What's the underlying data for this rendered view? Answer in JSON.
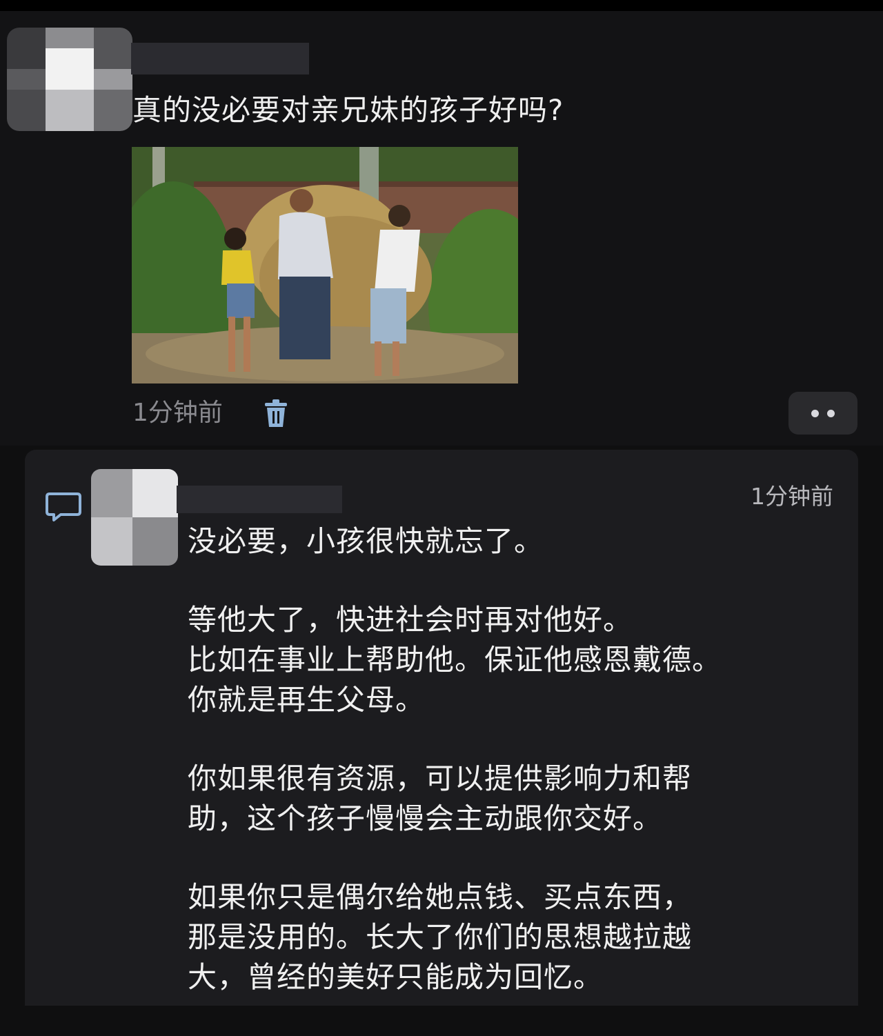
{
  "post": {
    "title": "真的没必要对亲兄妹的孩子好吗?",
    "time": "1分钟前"
  },
  "comment": {
    "time": "1分钟前",
    "paragraphs": [
      [
        "没必要，小孩很快就忘了。"
      ],
      [
        "等他大了，快进社会时再对他好。",
        "比如在事业上帮助他。保证他感恩戴德。",
        "你就是再生父母。"
      ],
      [
        "你如果很有资源，可以提供影响力和帮",
        "助，这个孩子慢慢会主动跟你交好。"
      ],
      [
        "如果你只是偶尔给她点钱、买点东西，",
        "那是没用的。长大了你们的思想越拉越",
        "大，曾经的美好只能成为回忆。"
      ]
    ]
  },
  "icons": {
    "delete": "trash-icon",
    "more": "more-dots-icon",
    "reply": "comment-bubble-icon"
  },
  "colors": {
    "background": "#0f0f10",
    "comment_panel": "#1c1c1f",
    "muted_text": "#8a8a8f",
    "accent_icon": "#8fb3d9"
  }
}
